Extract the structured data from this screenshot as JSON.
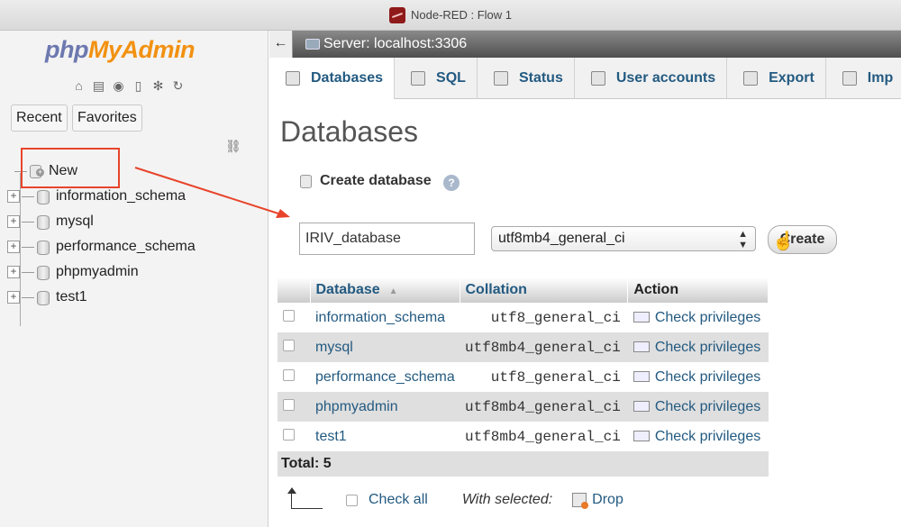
{
  "window": {
    "title": "Node-RED : Flow 1"
  },
  "nav": {
    "logo_php": "php",
    "logo_myadmin": "MyAdmin",
    "recent_label": "Recent",
    "favorites_label": "Favorites",
    "new_label": "New",
    "databases": [
      "information_schema",
      "mysql",
      "performance_schema",
      "phpmyadmin",
      "test1"
    ]
  },
  "serverbar": {
    "label": "Server: localhost:3306"
  },
  "tabs": [
    {
      "label": "Databases",
      "icon": "database-icon"
    },
    {
      "label": "SQL",
      "icon": "sql-icon"
    },
    {
      "label": "Status",
      "icon": "status-icon"
    },
    {
      "label": "User accounts",
      "icon": "users-icon"
    },
    {
      "label": "Export",
      "icon": "export-icon"
    },
    {
      "label": "Imp",
      "icon": "import-icon"
    }
  ],
  "page": {
    "title": "Databases"
  },
  "create": {
    "heading": "Create database",
    "name_value": "IRIV_database",
    "collation_value": "utf8mb4_general_ci",
    "button_label": "Create"
  },
  "table": {
    "headers": [
      "Database",
      "Collation",
      "Action"
    ],
    "rows": [
      {
        "name": "information_schema",
        "collation": "utf8_general_ci",
        "action": "Check privileges"
      },
      {
        "name": "mysql",
        "collation": "utf8mb4_general_ci",
        "action": "Check privileges"
      },
      {
        "name": "performance_schema",
        "collation": "utf8_general_ci",
        "action": "Check privileges"
      },
      {
        "name": "phpmyadmin",
        "collation": "utf8mb4_general_ci",
        "action": "Check privileges"
      },
      {
        "name": "test1",
        "collation": "utf8mb4_general_ci",
        "action": "Check privileges"
      }
    ],
    "total": "Total: 5"
  },
  "bulk": {
    "check_all": "Check all",
    "with_selected": "With selected:",
    "drop": "Drop"
  },
  "colors": {
    "annotation": "#e8442b",
    "link": "#235a81",
    "logo_php": "#6c78af",
    "logo_myadmin": "#f29111"
  }
}
